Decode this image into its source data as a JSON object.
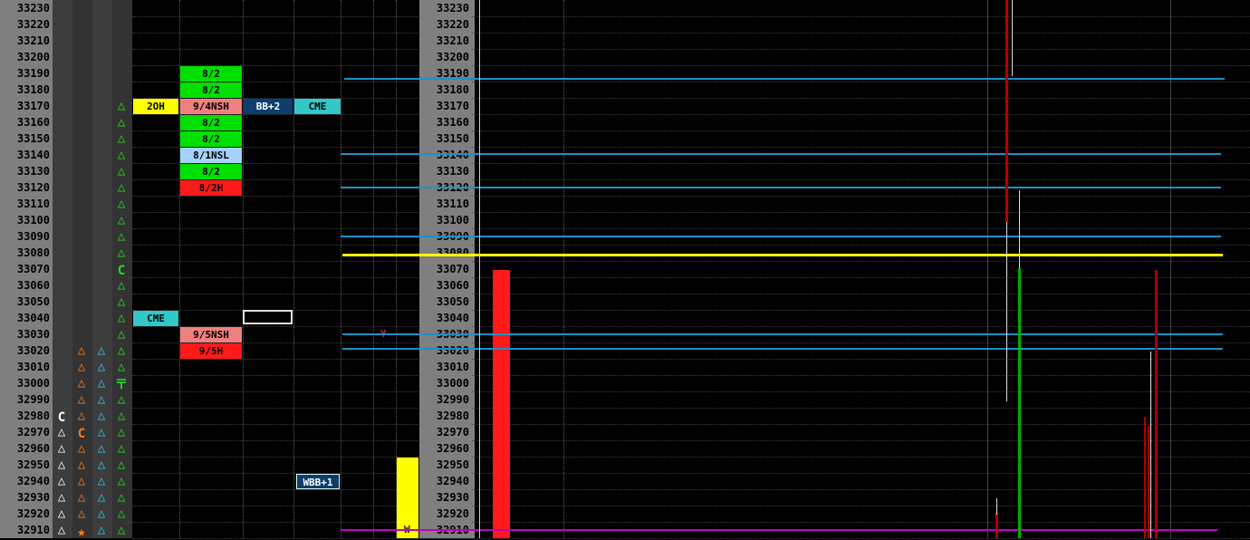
{
  "left_ladder": [
    "33230",
    "33220",
    "33210",
    "33200",
    "33190",
    "33180",
    "33170",
    "33160",
    "33150",
    "33140",
    "33130",
    "33120",
    "33110",
    "33100",
    "33090",
    "33080",
    "33070",
    "33060",
    "33050",
    "33040",
    "33030",
    "33020",
    "33010",
    "33000",
    "32990",
    "32980",
    "32970",
    "32960",
    "32950",
    "32940",
    "32930",
    "32920",
    "32910"
  ],
  "right_ladder": [
    "33230",
    "33220",
    "33210",
    "33200",
    "33190",
    "33180",
    "33170",
    "33160",
    "33150",
    "33140",
    "33130",
    "33120",
    "33110",
    "33100",
    "33090",
    "33080",
    "33070",
    "33060",
    "33050",
    "33040",
    "33030",
    "33020",
    "33010",
    "33000",
    "32990",
    "32980",
    "32970",
    "32960",
    "32950",
    "32940",
    "32930",
    "32920",
    "32910"
  ],
  "tags": {
    "t_2oh": "2OH",
    "t_94nsh": "9/4NSH",
    "t_bb2": "BB+2",
    "t_cme1": "CME",
    "t_82a": "8/2",
    "t_82b": "8/2",
    "t_82c": "8/2",
    "t_82d": "8/2",
    "t_82e": "8/2",
    "t_81nsl": "8/1NSL",
    "t_82f": "8/2",
    "t_82h": "8/2H",
    "t_cme2": "CME",
    "t_95nsh": "9/5NSH",
    "t_95h": "9/5H",
    "t_wbb1": "WBB+1",
    "t_y": "Y",
    "t_w": "W"
  },
  "tpo_letters": {
    "c4_33070": "C",
    "c4_33000": "〒",
    "c1_32980": "C",
    "c2_32970": "C",
    "c2_32910": "★"
  },
  "colors": {
    "green": "#00e000",
    "salmon": "#f08080",
    "light_blue": "#a6d2ff",
    "red": "#ff1a1a",
    "yellow": "#ffff00",
    "cyan": "#33c8c8",
    "navy": "#0e3e6e",
    "blue_line": "#1e90c8",
    "magenta_line": "#c000c0",
    "orange_tri": "#ff7b1a",
    "cyan_tri": "#38c8e8",
    "green_tri": "#20e020"
  }
}
